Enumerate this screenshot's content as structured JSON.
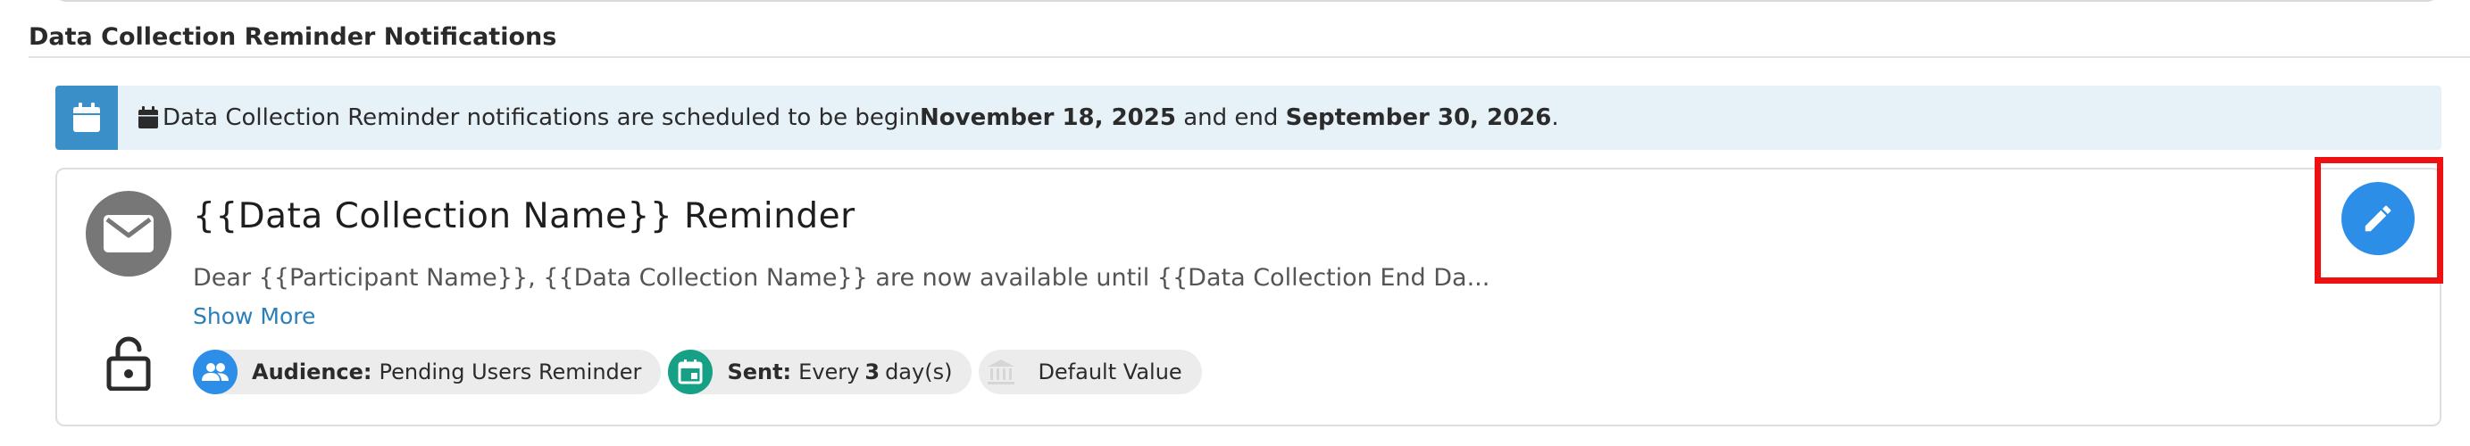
{
  "section": {
    "title": "Data Collection Reminder Notifications"
  },
  "banner": {
    "text_before": "Data Collection Reminder notifications are scheduled to be begin ",
    "start_date": "November 18, 2025",
    "text_middle": " and end ",
    "end_date": "September 30, 2026",
    "text_after": "."
  },
  "notification": {
    "title": "{{Data Collection Name}} Reminder",
    "body": "Dear {{Participant Name}}, {{Data Collection Name}} are now available until {{Data Collection End Da...",
    "show_more": "Show More",
    "chips": {
      "audience_label": "Audience:",
      "audience_value": "Pending Users Reminder",
      "sent_label": "Sent:",
      "sent_prefix": "Every",
      "sent_number": "3",
      "sent_suffix": "day(s)",
      "default_label": "Default Value"
    }
  },
  "icons": {
    "banner": "calendar-icon",
    "avatar": "envelope-icon",
    "lock": "lock-open-icon",
    "audience": "people-icon",
    "sent": "event-icon",
    "default": "institution-icon",
    "edit": "pencil-icon"
  },
  "colors": {
    "banner_bg": "#e6f1f8",
    "banner_accent": "#3b8fc9",
    "audience_icon": "#2d8ee8",
    "sent_icon": "#16a085",
    "edit_button": "#2d8ee8",
    "highlight": "#ee1111"
  }
}
